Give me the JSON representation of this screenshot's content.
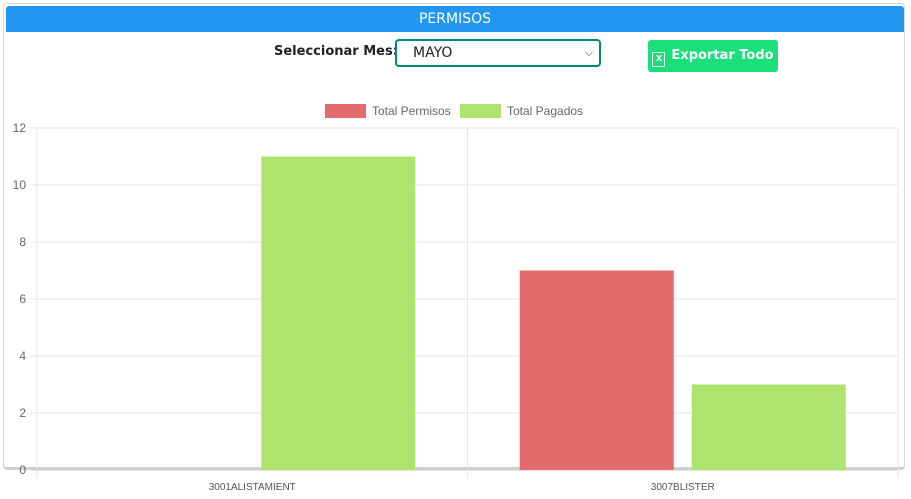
{
  "header": {
    "title": "PERMISOS"
  },
  "filter": {
    "label": "Seleccionar Mes:",
    "selected": "MAYO"
  },
  "actions": {
    "export_label": "Exportar Todo"
  },
  "colors": {
    "header": "#2196f3",
    "permisos": "#e36b6d",
    "pagados": "#aee46d",
    "export": "#19e07a",
    "select_border": "#00897b"
  },
  "chart_data": {
    "type": "bar",
    "categories": [
      "3001ALISTAMIENT",
      "3007BLISTER"
    ],
    "series": [
      {
        "name": "Total Permisos",
        "values": [
          0,
          7
        ]
      },
      {
        "name": "Total Pagados",
        "values": [
          11,
          3
        ]
      }
    ],
    "ylim": [
      0,
      12
    ],
    "yticks": [
      "0",
      "2",
      "4",
      "6",
      "8",
      "10",
      "12"
    ],
    "legend_position": "top",
    "grid": true
  }
}
